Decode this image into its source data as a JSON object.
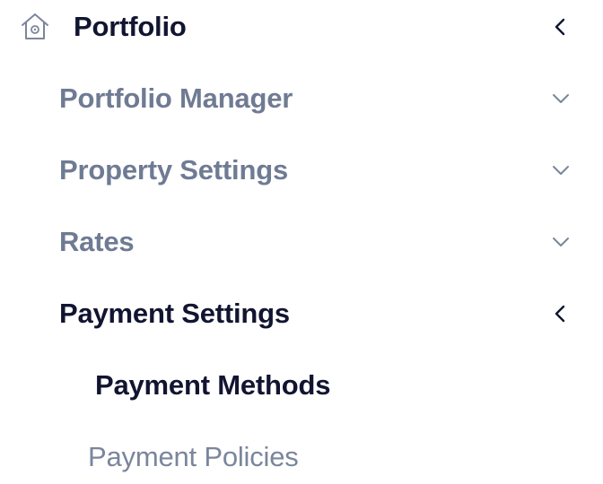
{
  "nav": {
    "root": {
      "label": "Portfolio",
      "icon": "home-icon",
      "expanded": true,
      "chevron_icon": "chevron-left-icon"
    },
    "items": [
      {
        "label": "Portfolio Manager",
        "expanded": false,
        "chevron_icon": "chevron-down-icon"
      },
      {
        "label": "Property Settings",
        "expanded": false,
        "chevron_icon": "chevron-down-icon"
      },
      {
        "label": "Rates",
        "expanded": false,
        "chevron_icon": "chevron-down-icon"
      },
      {
        "label": "Payment Settings",
        "expanded": true,
        "active": true,
        "chevron_icon": "chevron-left-icon",
        "children": [
          {
            "label": "Payment Methods",
            "active": true
          },
          {
            "label": "Payment Policies",
            "active": false
          }
        ]
      }
    ]
  },
  "colors": {
    "active_text": "#111530",
    "inactive_text": "#6f7b93",
    "muted_text": "#7a869c",
    "icon_stroke": "#7a869c",
    "background": "#ffffff"
  }
}
